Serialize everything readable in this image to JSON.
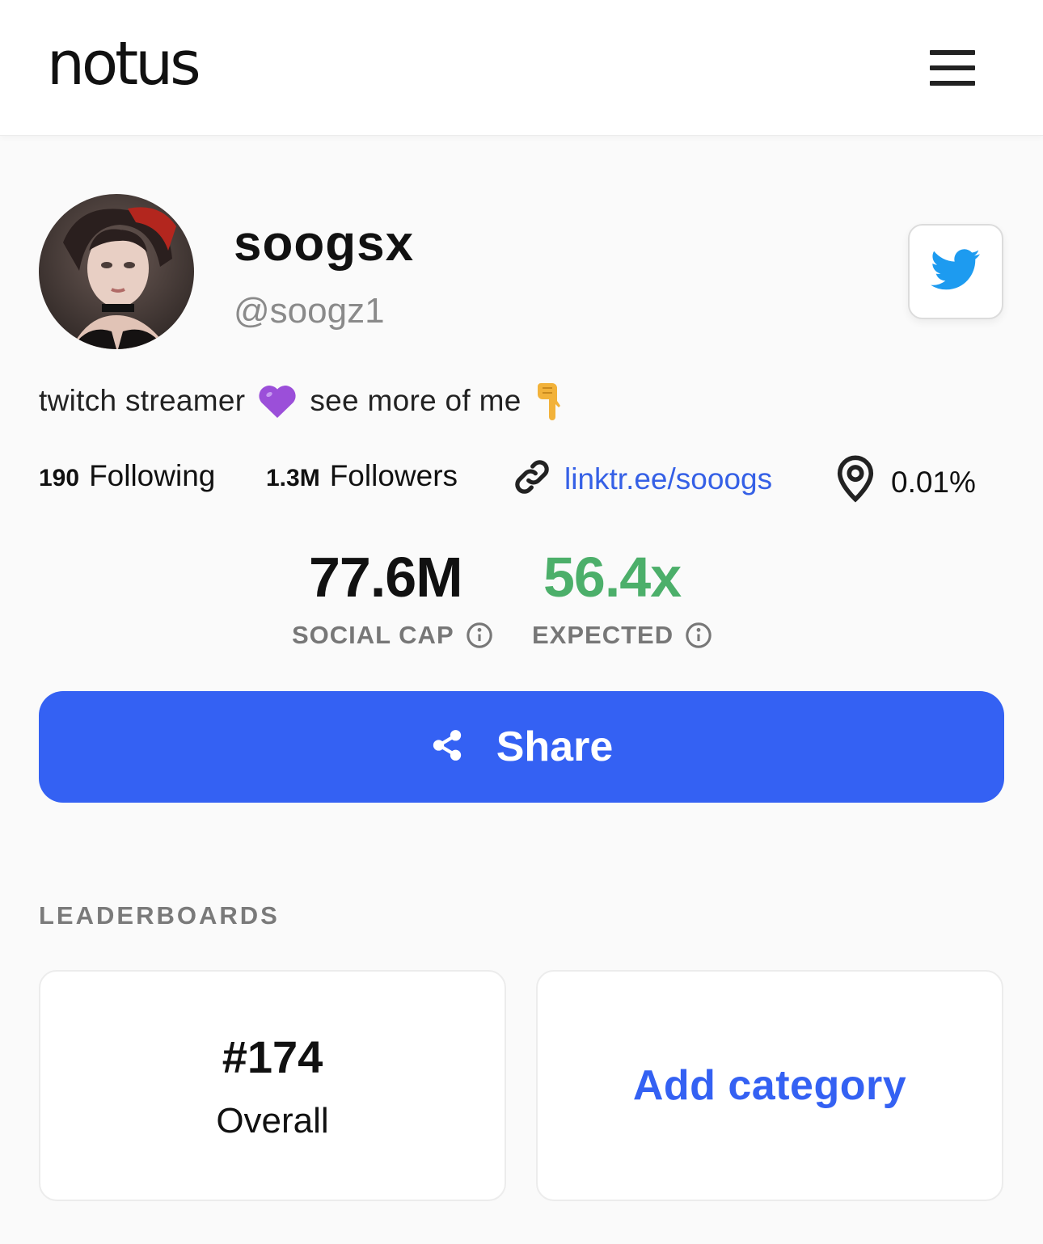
{
  "header": {
    "logo": "notus",
    "menu_icon": "hamburger-menu-icon"
  },
  "profile": {
    "display_name": "soogsx",
    "handle": "@soogz1",
    "bio_part1": "twitch streamer",
    "bio_emoji1": "purple-heart",
    "bio_part2": "see more of me",
    "bio_emoji2": "backhand-index-pointing-down",
    "twitter_icon": "twitter-icon"
  },
  "stats": {
    "following_count": "190",
    "following_label": "Following",
    "followers_count": "1.3M",
    "followers_label": "Followers",
    "link": "linktr.ee/sooogs",
    "location_value": "0.01%"
  },
  "metrics": {
    "social_cap_value": "77.6M",
    "social_cap_label": "SOCIAL CAP",
    "expected_value": "56.4x",
    "expected_label": "EXPECTED"
  },
  "share": {
    "label": "Share"
  },
  "leaderboards": {
    "title": "LEADERBOARDS",
    "rank": "#174",
    "rank_label": "Overall",
    "add_category": "Add category"
  },
  "colors": {
    "accent": "#3461f3",
    "link": "#3560e6",
    "expected_green": "#4caf6a",
    "muted": "#8a8a8a"
  }
}
